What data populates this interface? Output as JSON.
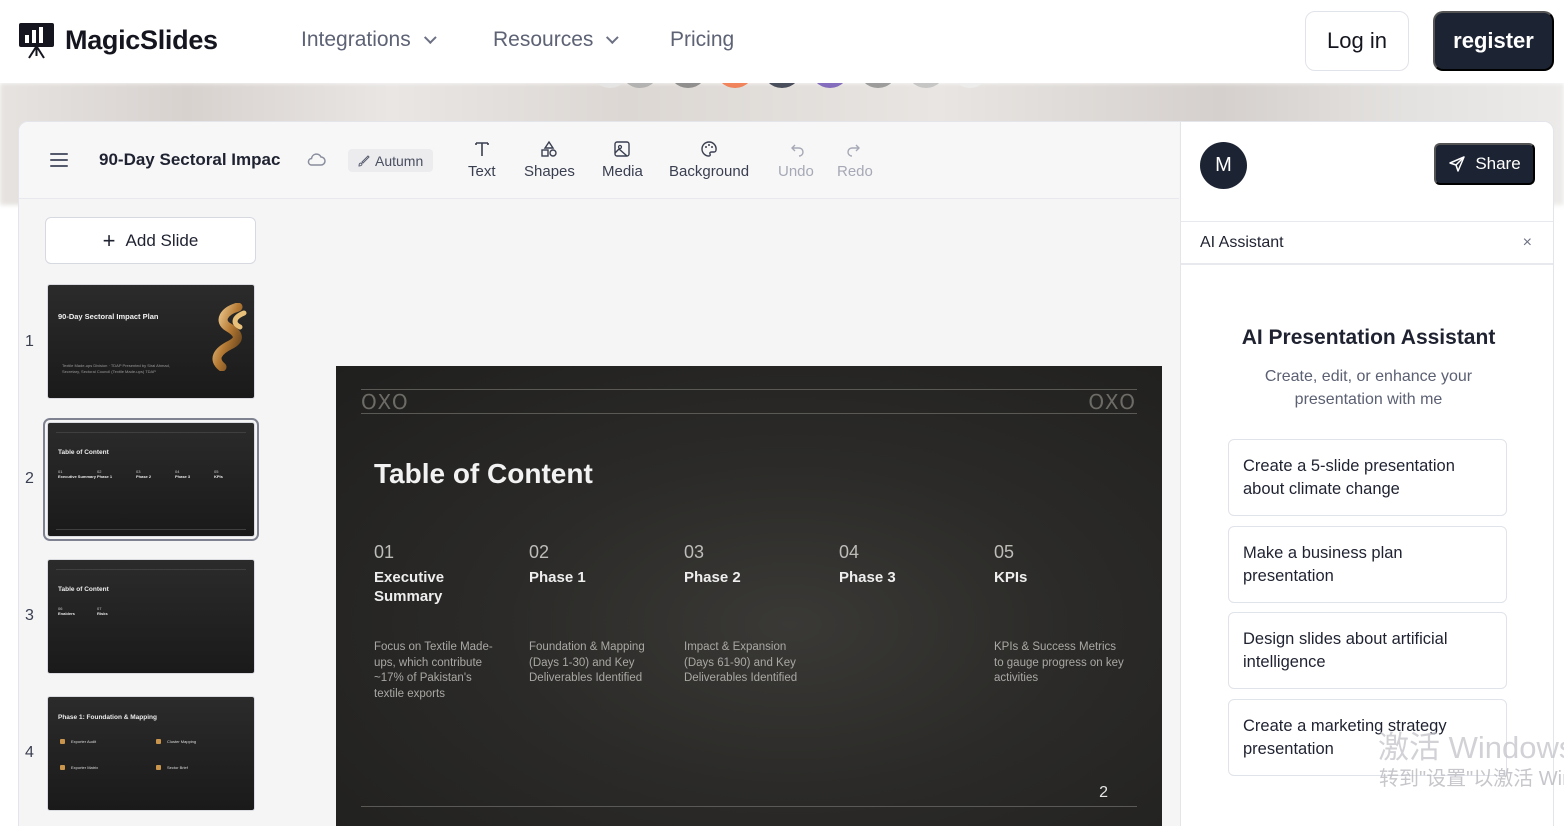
{
  "nav": {
    "brand": "MagicSlides",
    "links": [
      "Integrations",
      "Resources",
      "Pricing"
    ],
    "login": "Log in",
    "register": "register"
  },
  "toolbar": {
    "doc_title": "90-Day Sectoral Impac",
    "theme": "Autumn",
    "tools": [
      "Text",
      "Shapes",
      "Media",
      "Background",
      "Undo",
      "Redo"
    ]
  },
  "slides_panel": {
    "add_slide": "Add Slide",
    "numbers": [
      "1",
      "2",
      "3",
      "4"
    ],
    "thumb1": {
      "title": "90-Day Sectoral Impact Plan",
      "sub": "Textile Made-ups Division · TDAP Presented by Sirai Ahmad, Secretary, Sectoral Council (Textile Made-ups) TDAP"
    },
    "thumb2": {
      "title": "Table of Content",
      "cols": [
        {
          "num": "01",
          "name": "Executive Summary"
        },
        {
          "num": "02",
          "name": "Phase 1"
        },
        {
          "num": "03",
          "name": "Phase 2"
        },
        {
          "num": "04",
          "name": "Phase 3"
        },
        {
          "num": "05",
          "name": "KPIs"
        }
      ]
    },
    "thumb3": {
      "title": "Table of Content",
      "cols": [
        {
          "num": "06",
          "name": "Enablers"
        },
        {
          "num": "07",
          "name": "Risks"
        }
      ]
    },
    "thumb4": {
      "title": "Phase 1: Foundation & Mapping",
      "items": [
        "Exporter Audit",
        "Cluster Mapping",
        "Exporter Matrix",
        "Sector Brief"
      ]
    }
  },
  "slide": {
    "title": "Table of Content",
    "page": "2",
    "columns": [
      {
        "num": "01",
        "name": "Executive Summary",
        "desc": "Focus on Textile Made-ups, which contribute ~17% of Pakistan's textile exports"
      },
      {
        "num": "02",
        "name": "Phase 1",
        "desc": "Foundation & Mapping (Days 1-30) and Key Deliverables Identified"
      },
      {
        "num": "03",
        "name": "Phase 2",
        "desc": "Impact & Expansion (Days 61-90) and Key Deliverables Identified"
      },
      {
        "num": "04",
        "name": "Phase 3",
        "desc": ""
      },
      {
        "num": "05",
        "name": "KPIs",
        "desc": "KPIs & Success Metrics to gauge progress on key activities"
      }
    ]
  },
  "right_panel": {
    "avatar": "M",
    "share": "Share",
    "assistant_tab": "AI Assistant",
    "close": "×",
    "heading": "AI Presentation Assistant",
    "subheading": "Create, edit, or enhance your presentation with me",
    "suggestions": [
      "Create a 5-slide presentation about climate change",
      "Make a business plan presentation",
      "Design slides about artificial intelligence",
      "Create a marketing strategy presentation"
    ]
  },
  "watermark": {
    "line1": "激活 Windows",
    "line2": "转到\"设置\"以激活 Windows。"
  },
  "colors": {
    "primary_dark": "#1c2333",
    "slide_bg": "#2b2a28",
    "accent_orange": "#f26b3a",
    "accent_purple": "#6a4fb3"
  }
}
